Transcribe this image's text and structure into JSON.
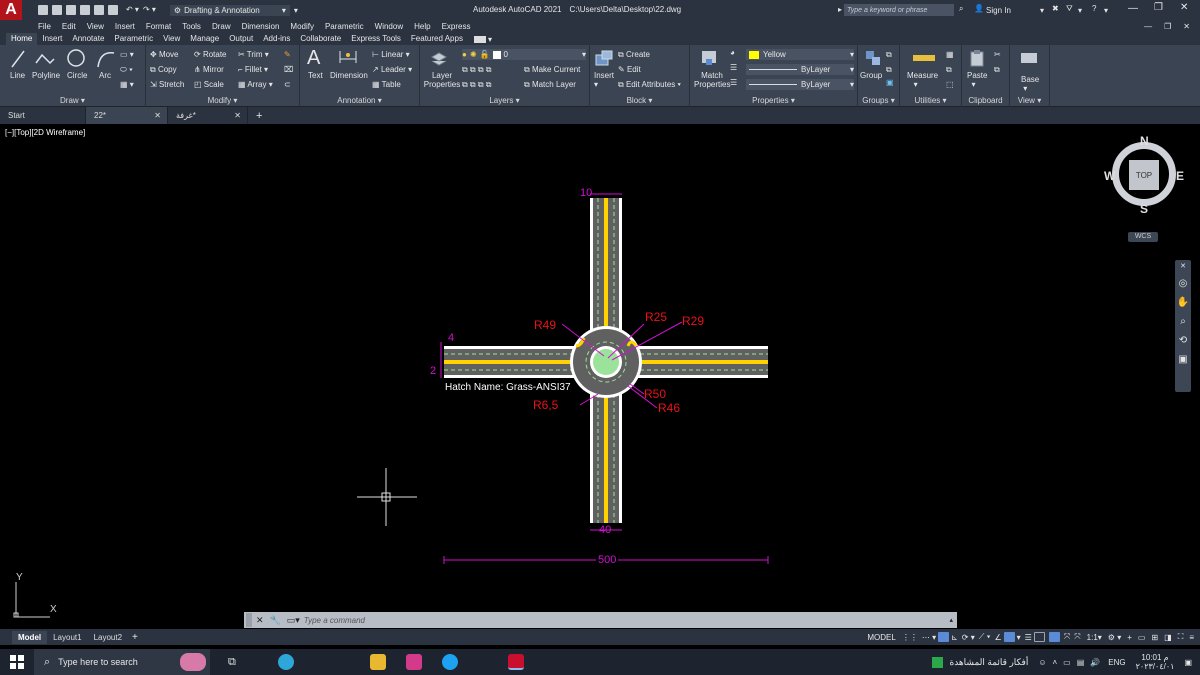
{
  "app": {
    "title": "Autodesk AutoCAD 2021",
    "file_path": "C:\\Users\\Delta\\Desktop\\22.dwg",
    "workspace": "Drafting & Annotation",
    "search_placeholder": "Type a keyword or phrase",
    "sign_in": "Sign In",
    "logo_letter": "A"
  },
  "menu": [
    "File",
    "Edit",
    "View",
    "Insert",
    "Format",
    "Tools",
    "Draw",
    "Dimension",
    "Modify",
    "Parametric",
    "Window",
    "Help",
    "Express"
  ],
  "ribbon_tabs": [
    "Home",
    "Insert",
    "Annotate",
    "Parametric",
    "View",
    "Manage",
    "Output",
    "Add-ins",
    "Collaborate",
    "Express Tools",
    "Featured Apps"
  ],
  "ribbon": {
    "draw": {
      "title": "Draw",
      "tools": [
        "Line",
        "Polyline",
        "Circle",
        "Arc"
      ]
    },
    "modify": {
      "title": "Modify",
      "tools": [
        "Move",
        "Rotate",
        "Trim",
        "Copy",
        "Mirror",
        "Fillet",
        "Stretch",
        "Scale",
        "Array"
      ]
    },
    "annotation": {
      "title": "Annotation",
      "tools": [
        "Text",
        "Dimension",
        "Linear",
        "Leader",
        "Table"
      ]
    },
    "layers": {
      "title": "Layers",
      "layer_props": "Layer Properties",
      "current_layer": "0",
      "make_current": "Make Current",
      "match_layer": "Match Layer"
    },
    "block": {
      "title": "Block",
      "insert": "Insert",
      "create": "Create",
      "edit": "Edit",
      "edit_attributes": "Edit Attributes"
    },
    "properties": {
      "title": "Properties",
      "match": "Match Properties",
      "color": "Yellow",
      "linetype": "ByLayer",
      "lineweight": "ByLayer"
    },
    "groups": {
      "title": "Groups",
      "group": "Group"
    },
    "utilities": {
      "title": "Utilities",
      "measure": "Measure"
    },
    "clipboard": {
      "title": "Clipboard",
      "paste": "Paste"
    },
    "view": {
      "title": "View",
      "base": "Base"
    }
  },
  "doc_tabs": [
    "Start",
    "22*",
    "غرفة*"
  ],
  "viewport_label": "[−][Top][2D Wireframe]",
  "viewcube": {
    "top": "TOP",
    "n": "N",
    "s": "S",
    "w": "W",
    "e": "E",
    "ucs": "WCS"
  },
  "drawing": {
    "hatch_label": "Hatch Name: Grass-ANSI37",
    "dims": {
      "d10": "10",
      "d4": "4",
      "d2": "2",
      "d40": "40",
      "d500": "500"
    },
    "radii": {
      "r49": "R49",
      "r25": "R25",
      "r29": "R29",
      "r50": "R50",
      "r46": "R46",
      "r65": "R6,5"
    }
  },
  "ucs_icon": {
    "x": "X",
    "y": "Y"
  },
  "command_placeholder": "Type a command",
  "layout_tabs": [
    "Model",
    "Layout1",
    "Layout2"
  ],
  "status": {
    "model": "MODEL",
    "scale": "1:1"
  },
  "taskbar": {
    "search_placeholder": "Type here to search",
    "arabic_notice": "أفكار قائمة المشاهدة",
    "lang": "ENG",
    "time": "10:01 م",
    "date": "٢٠٢٣/٠٤/٠١"
  },
  "colors": {
    "accent": "#c8102e",
    "dim": "#d40fd4",
    "radius_text": "#e8121a",
    "road_yellow": "#ffd200",
    "grass": "#9be29b"
  }
}
